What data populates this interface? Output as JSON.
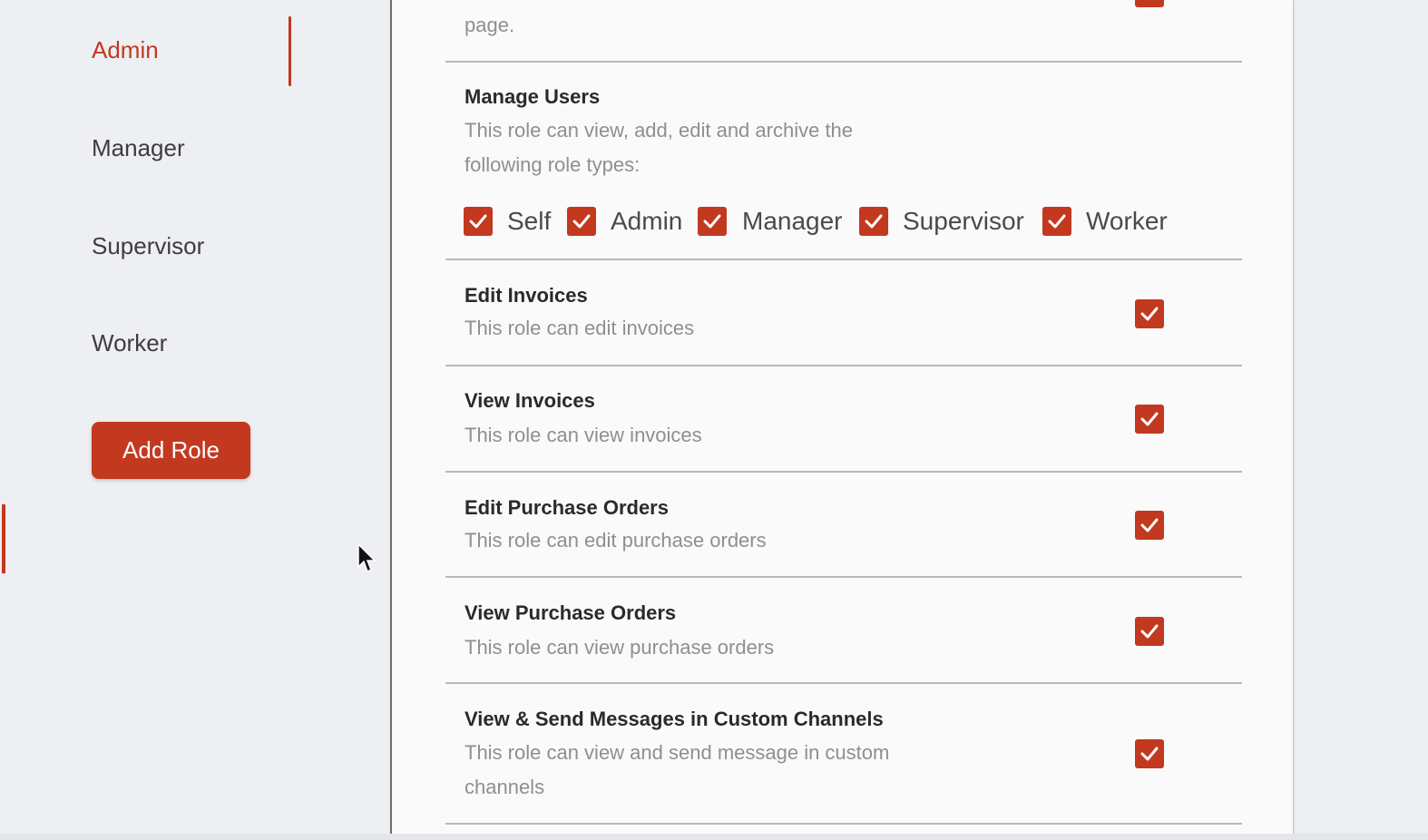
{
  "sidebar": {
    "roles": [
      "Admin",
      "Manager",
      "Supervisor",
      "Worker"
    ],
    "active_role": "Admin",
    "add_role_label": "Add Role"
  },
  "panel": {
    "prev_desc_tail": "page.",
    "manage_users": {
      "title": "Manage Users",
      "desc": "This role can view, add, edit and archive the following role types:",
      "role_types": [
        {
          "label": "Self",
          "checked": true
        },
        {
          "label": "Admin",
          "checked": true
        },
        {
          "label": "Manager",
          "checked": true
        },
        {
          "label": "Supervisor",
          "checked": true
        },
        {
          "label": "Worker",
          "checked": true
        }
      ]
    },
    "permissions": [
      {
        "title": "Edit Invoices",
        "desc": "This role can edit invoices",
        "checked": true
      },
      {
        "title": "View Invoices",
        "desc": "This role can view invoices",
        "checked": true
      },
      {
        "title": "Edit Purchase Orders",
        "desc": "This role can edit purchase orders",
        "checked": true
      },
      {
        "title": "View Purchase Orders",
        "desc": "This role can view purchase orders",
        "checked": true
      },
      {
        "title": "View & Send Messages in Custom Channels",
        "desc": "This role can view and send message in custom channels",
        "checked": true
      }
    ]
  },
  "colors": {
    "accent": "#c2391f"
  }
}
